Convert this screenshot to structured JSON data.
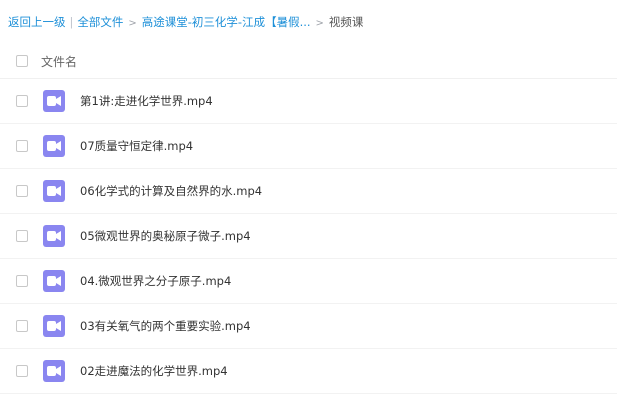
{
  "breadcrumb": {
    "back": "返回上一级",
    "separator": "|",
    "root": "全部文件",
    "folder": "高途课堂-初三化学-江成【暑假...",
    "current": "视频课"
  },
  "table": {
    "header_label": "文件名"
  },
  "files": [
    {
      "name": "第1讲:走进化学世界.mp4"
    },
    {
      "name": "07质量守恒定律.mp4"
    },
    {
      "name": "06化学式的计算及自然界的水.mp4"
    },
    {
      "name": "05微观世界的奥秘原子微子.mp4"
    },
    {
      "name": "04.微观世界之分子原子.mp4"
    },
    {
      "name": "03有关氧气的两个重要实验.mp4"
    },
    {
      "name": "02走进魔法的化学世界.mp4"
    }
  ],
  "icons": {
    "video_file": "video-file-icon",
    "accent_color": "#8a86f0",
    "link_color": "#1e90d8"
  }
}
